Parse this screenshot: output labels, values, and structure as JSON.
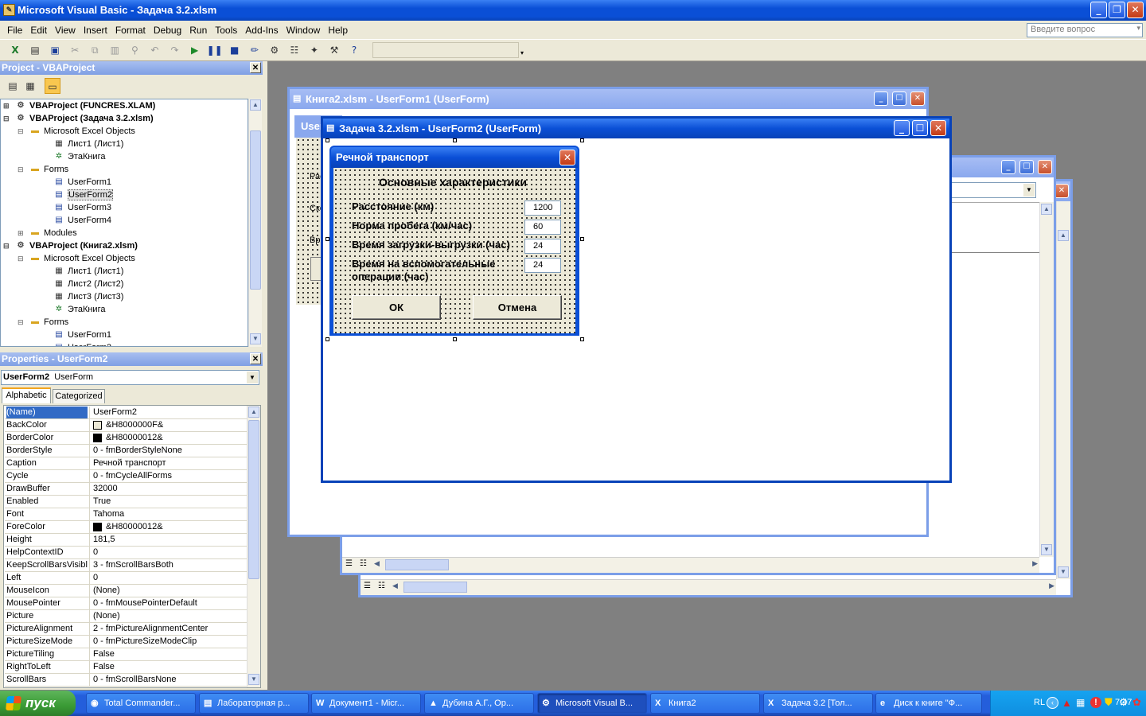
{
  "window": {
    "title": "Microsoft Visual Basic - Задача 3.2.xlsm"
  },
  "menu": {
    "items": [
      "File",
      "Edit",
      "View",
      "Insert",
      "Format",
      "Debug",
      "Run",
      "Tools",
      "Add-Ins",
      "Window",
      "Help"
    ],
    "ask_placeholder": "Введите вопрос"
  },
  "project": {
    "title": "Project - VBAProject",
    "nodes": [
      {
        "label": "VBAProject (FUNCRES.XLAM)"
      },
      {
        "label": "VBAProject (Задача 3.2.xlsm)"
      },
      {
        "label": "Microsoft Excel Objects"
      },
      {
        "label": "Лист1 (Лист1)"
      },
      {
        "label": "ЭтаКнига"
      },
      {
        "label": "Forms"
      },
      {
        "label": "UserForm1"
      },
      {
        "label": "UserForm2"
      },
      {
        "label": "UserForm3"
      },
      {
        "label": "UserForm4"
      },
      {
        "label": "Modules"
      },
      {
        "label": "VBAProject (Книга2.xlsm)"
      },
      {
        "label": "Microsoft Excel Objects"
      },
      {
        "label": "Лист1 (Лист1)"
      },
      {
        "label": "Лист2 (Лист2)"
      },
      {
        "label": "Лист3 (Лист3)"
      },
      {
        "label": "ЭтаКнига"
      },
      {
        "label": "Forms"
      },
      {
        "label": "UserForm1"
      },
      {
        "label": "UserForm2"
      }
    ]
  },
  "properties": {
    "title": "Properties - UserForm2",
    "object_name": "UserForm2",
    "object_type": "UserForm",
    "tab_alpha": "Alphabetic",
    "tab_cat": "Categorized",
    "rows": [
      {
        "k": "(Name)",
        "v": "UserForm2"
      },
      {
        "k": "BackColor",
        "v": "&H8000000F&"
      },
      {
        "k": "BorderColor",
        "v": "&H80000012&"
      },
      {
        "k": "BorderStyle",
        "v": "0 - fmBorderStyleNone"
      },
      {
        "k": "Caption",
        "v": "Речной транспорт"
      },
      {
        "k": "Cycle",
        "v": "0 - fmCycleAllForms"
      },
      {
        "k": "DrawBuffer",
        "v": "32000"
      },
      {
        "k": "Enabled",
        "v": "True"
      },
      {
        "k": "Font",
        "v": "Tahoma"
      },
      {
        "k": "ForeColor",
        "v": "&H80000012&"
      },
      {
        "k": "Height",
        "v": "181,5"
      },
      {
        "k": "HelpContextID",
        "v": "0"
      },
      {
        "k": "KeepScrollBarsVisible",
        "v": "3 - fmScrollBarsBoth"
      },
      {
        "k": "Left",
        "v": "0"
      },
      {
        "k": "MouseIcon",
        "v": "(None)"
      },
      {
        "k": "MousePointer",
        "v": "0 - fmMousePointerDefault"
      },
      {
        "k": "Picture",
        "v": "(None)"
      },
      {
        "k": "PictureAlignment",
        "v": "2 - fmPictureAlignmentCenter"
      },
      {
        "k": "PictureSizeMode",
        "v": "0 - fmPictureSizeModeClip"
      },
      {
        "k": "PictureTiling",
        "v": "False"
      },
      {
        "k": "RightToLeft",
        "v": "False"
      },
      {
        "k": "ScrollBars",
        "v": "0 - fmScrollBarsNone"
      }
    ],
    "colors": {
      "BackColor": "#ece9d8",
      "BorderColor": "#000000",
      "ForeColor": "#000000"
    }
  },
  "windows": {
    "userform1_title": "Книга2.xlsm - UserForm1 (UserForm)",
    "userform1_peek": "User",
    "userform1_labels": [
      "Расс",
      "Ско",
      "Вре"
    ],
    "userform2_title": "Задача 3.2.xlsm - UserForm2 (UserForm)"
  },
  "form": {
    "caption": "Речной транспорт",
    "heading": "Основные характеристики",
    "fields": [
      {
        "label": "Расстояние (км)",
        "value": "1200"
      },
      {
        "label": "Норма пробега (км/час)",
        "value": "60"
      },
      {
        "label": "Время загрузки-выгрузки (час)",
        "value": "24"
      },
      {
        "label": "Время на вспомогательные операции (час)",
        "value": "24"
      }
    ],
    "ok": "ОК",
    "cancel": "Отмена"
  },
  "taskbar": {
    "start": "пуск",
    "tasks": [
      "Total Commander...",
      "Лабораторная р...",
      "Документ1 - Micr...",
      "Дубина А.Г., Ор...",
      "Microsoft Visual B...",
      "Книга2",
      "Задача 3.2  [Тол...",
      "Диск к книге \"Ф..."
    ],
    "lang": "RL",
    "clock": "7:47"
  }
}
